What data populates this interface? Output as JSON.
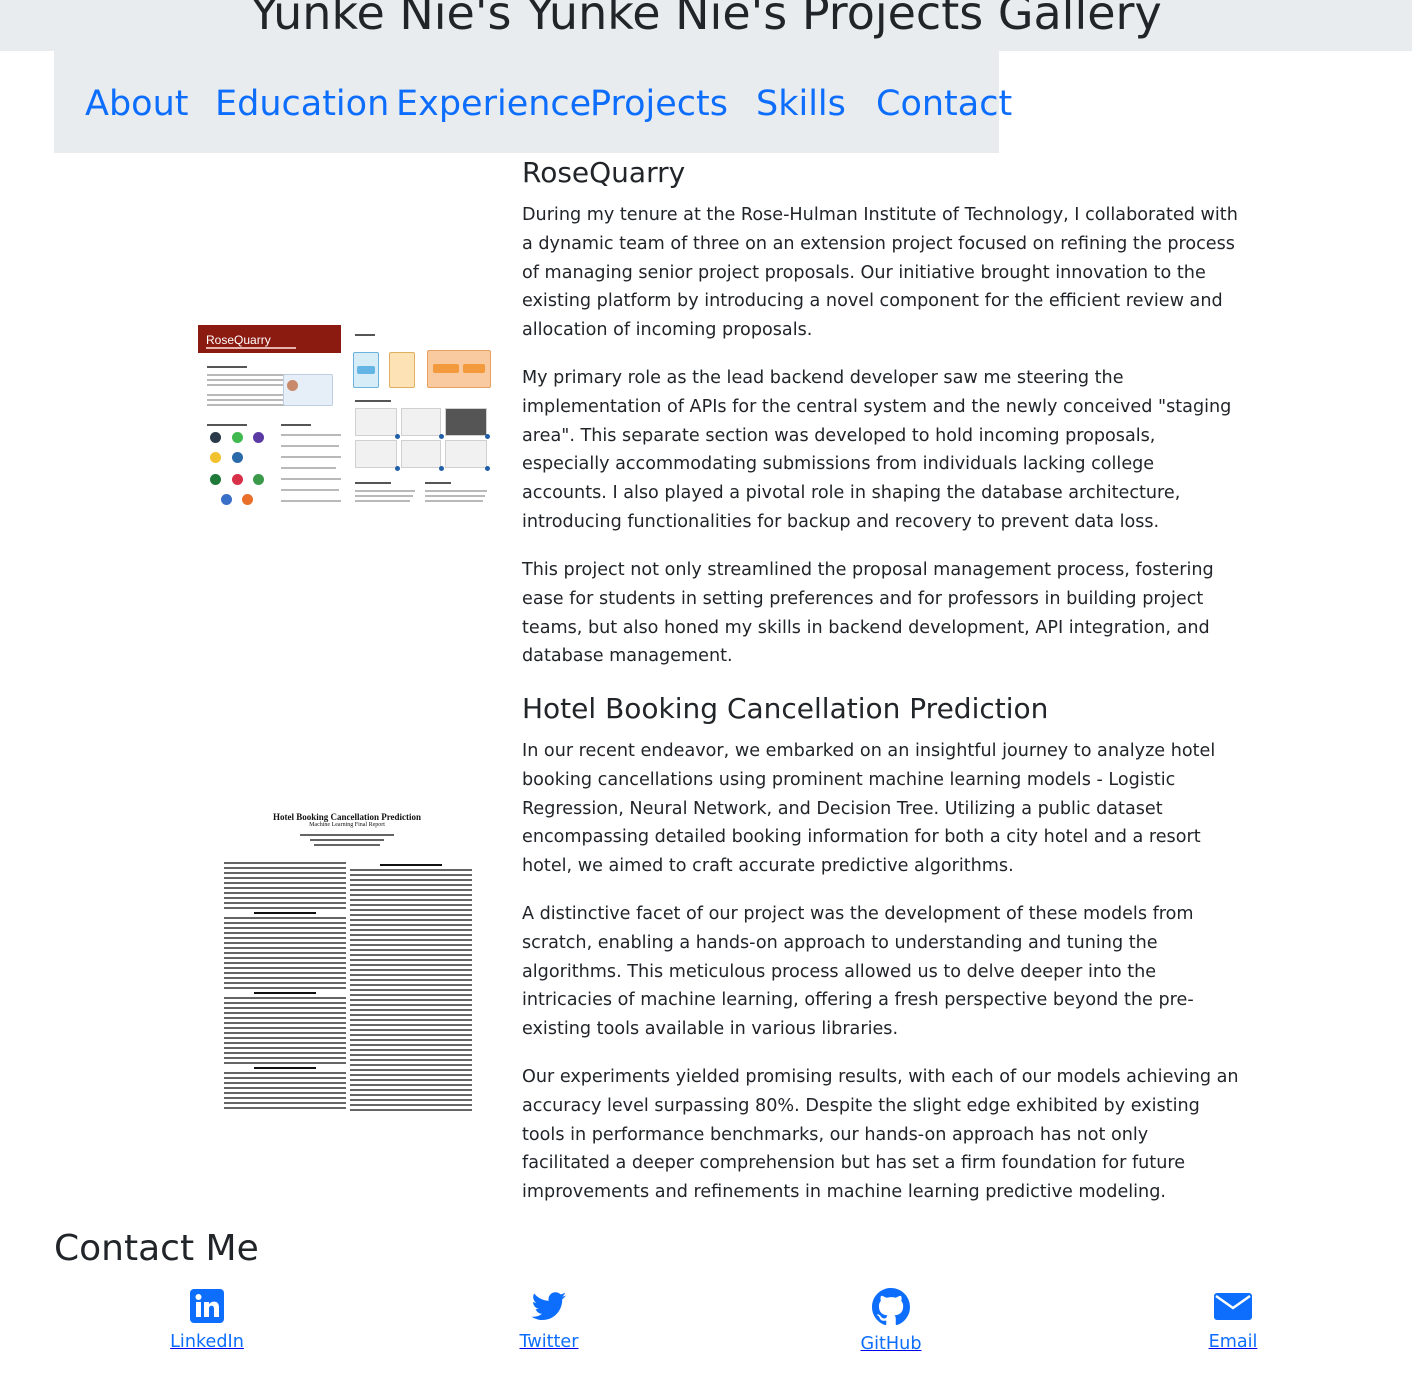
{
  "page": {
    "title": "Yunke Nie's Yunke Nie's Projects Gallery"
  },
  "nav": {
    "items": [
      {
        "label": "About"
      },
      {
        "label": "Education"
      },
      {
        "label": "Experience"
      },
      {
        "label": "Projects"
      },
      {
        "label": "Skills"
      },
      {
        "label": "Contact"
      }
    ]
  },
  "projects": [
    {
      "title": "RoseQuarry",
      "poster_title": "RoseQuarry",
      "paragraphs": [
        "During my tenure at the Rose-Hulman Institute of Technology, I collaborated with a dynamic team of three on an extension project focused on refining the process of managing senior project proposals. Our initiative brought innovation to the existing platform by introducing a novel component for the efficient review and allocation of incoming proposals.",
        "My primary role as the lead backend developer saw me steering the implementation of APIs for the central system and the newly conceived \"staging area\". This separate section was developed to hold incoming proposals, especially accommodating submissions from individuals lacking college accounts. I also played a pivotal role in shaping the database architecture, introducing functionalities for backup and recovery to prevent data loss.",
        "This project not only streamlined the proposal management process, fostering ease for students in setting preferences and for professors in building project teams, but also honed my skills in backend development, API integration, and database management."
      ]
    },
    {
      "title": "Hotel Booking Cancellation Prediction",
      "poster_title": "Hotel Booking Cancellation Prediction",
      "poster_subtitle": "Machine Learning Final Report",
      "paragraphs": [
        "In our recent endeavor, we embarked on an insightful journey to analyze hotel booking cancellations using prominent machine learning models - Logistic Regression, Neural Network, and Decision Tree. Utilizing a public dataset encompassing detailed booking information for both a city hotel and a resort hotel, we aimed to craft accurate predictive algorithms.",
        "A distinctive facet of our project was the development of these models from scratch, enabling a hands-on approach to understanding and tuning the algorithms. This meticulous process allowed us to delve deeper into the intricacies of machine learning, offering a fresh perspective beyond the pre-existing tools available in various libraries.",
        "Our experiments yielded promising results, with each of our models achieving an accuracy level surpassing 80%. Despite the slight edge exhibited by existing tools in performance benchmarks, our hands-on approach has not only facilitated a deeper comprehension but has set a firm foundation for future improvements and refinements in machine learning predictive modeling."
      ]
    }
  ],
  "contact": {
    "heading": "Contact Me",
    "links": [
      {
        "label": "LinkedIn",
        "icon": "linkedin-icon"
      },
      {
        "label": "Twitter",
        "icon": "twitter-icon"
      },
      {
        "label": "GitHub",
        "icon": "github-icon"
      },
      {
        "label": "Email",
        "icon": "envelope-icon"
      }
    ]
  },
  "colors": {
    "link": "#0d6efd",
    "header_bg": "#e9ecef",
    "text": "#212529",
    "poster_red": "#8b1a10"
  }
}
